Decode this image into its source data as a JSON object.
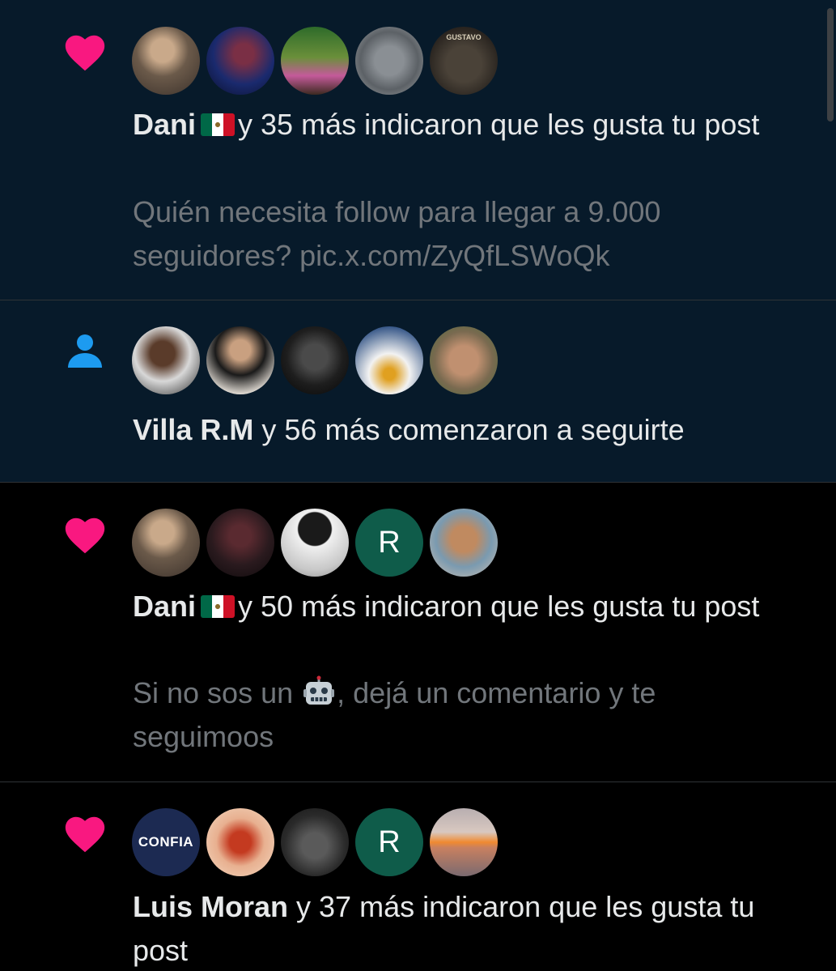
{
  "notifications": [
    {
      "type": "like",
      "icon": "heart-icon",
      "name": "Dani",
      "has_flag": true,
      "flag_icon": "mexico-flag-icon",
      "action_text": "y 35 más indicaron que les gusta tu post",
      "preview": "Quién necesita follow para llegar a 9.000 seguidores? pic.x.com/ZyQfLSWoQk"
    },
    {
      "type": "follow",
      "icon": "person-icon",
      "name": "Villa R.M",
      "action_text": "y 56 más comenzaron a seguirte"
    },
    {
      "type": "like",
      "icon": "heart-icon",
      "name": "Dani",
      "has_flag": true,
      "flag_icon": "mexico-flag-icon",
      "action_text": "y 50 más indicaron que les gusta tu post",
      "preview_before": "Si no sos un",
      "preview_emoji": "robot-emoji-icon",
      "preview_after": ", dejá un comentario y te seguimoos"
    },
    {
      "type": "like",
      "icon": "heart-icon",
      "name": "Luis Moran",
      "action_text": "y 37 más indicaron que les gusta tu post",
      "avatar_confia_text": "CONFIA",
      "avatar_letter": "R"
    }
  ],
  "avatar_letter_r": "R",
  "crest_text": "GUSTAVO",
  "colors": {
    "heart": "#f91880",
    "follow": "#1d9bf0",
    "unread_bg": "#071a2a",
    "read_bg": "#000000",
    "text_primary": "#e7e9ea",
    "text_secondary": "#71767b",
    "divider": "#2f3336",
    "avatar_r_bg": "#0f5c4a"
  }
}
